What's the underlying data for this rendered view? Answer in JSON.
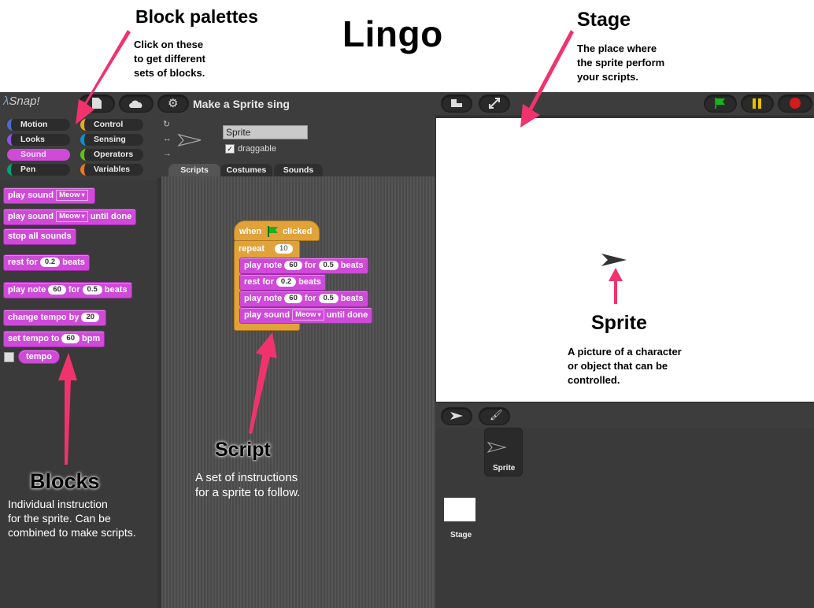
{
  "title": "Lingo",
  "annotations": {
    "palettes": {
      "heading": "Block palettes",
      "text": [
        "Click on these",
        "to get different",
        "sets of blocks."
      ]
    },
    "stage": {
      "heading": "Stage",
      "text": [
        "The place where",
        "the sprite perform",
        "your scripts."
      ]
    },
    "sprite": {
      "heading": "Sprite",
      "text": [
        "A picture of a character",
        "or object that can be",
        "controlled."
      ]
    },
    "script": {
      "heading": "Script",
      "text": [
        "A set of instructions",
        "for a sprite to follow."
      ]
    },
    "blocks": {
      "heading": "Blocks",
      "text": [
        "Individual instruction",
        "for the sprite. Can be",
        "combined to make scripts."
      ]
    }
  },
  "app": {
    "logo": "Snap!",
    "project_title": "Make a Sprite sing"
  },
  "categories": [
    {
      "label": "Motion",
      "color": "#4a6cd4",
      "selected": false
    },
    {
      "label": "Control",
      "color": "#e6a822",
      "selected": false
    },
    {
      "label": "Looks",
      "color": "#8f56e3",
      "selected": false
    },
    {
      "label": "Sensing",
      "color": "#0494dc",
      "selected": false
    },
    {
      "label": "Sound",
      "color": "#cf4ad9",
      "selected": true
    },
    {
      "label": "Operators",
      "color": "#62c213",
      "selected": false
    },
    {
      "label": "Pen",
      "color": "#00a178",
      "selected": false
    },
    {
      "label": "Variables",
      "color": "#f3761d",
      "selected": false
    }
  ],
  "palette_blocks": {
    "play_sound": {
      "pre": "play sound",
      "drop": "Meow"
    },
    "play_sound_done": {
      "pre": "play sound",
      "drop": "Meow",
      "post": "until done"
    },
    "stop_all": {
      "pre": "stop all sounds"
    },
    "rest": {
      "pre": "rest for",
      "num": "0.2",
      "post": "beats"
    },
    "play_note": {
      "pre": "play note",
      "num1": "60",
      "mid": "for",
      "num2": "0.5",
      "post": "beats"
    },
    "change_tempo": {
      "pre": "change tempo by",
      "num": "20"
    },
    "set_tempo": {
      "pre": "set tempo to",
      "num": "60",
      "post": "bpm"
    },
    "tempo": {
      "label": "tempo"
    }
  },
  "sprite": {
    "name": "Sprite",
    "draggable_label": "draggable",
    "draggable": true
  },
  "tabs": [
    {
      "label": "Scripts",
      "selected": true
    },
    {
      "label": "Costumes",
      "selected": false
    },
    {
      "label": "Sounds",
      "selected": false
    }
  ],
  "script": {
    "hat": {
      "pre": "when",
      "post": "clicked"
    },
    "repeat": {
      "label": "repeat",
      "num": "10"
    },
    "note1": {
      "pre": "play note",
      "num1": "60",
      "mid": "for",
      "num2": "0.5",
      "post": "beats"
    },
    "rest": {
      "pre": "rest for",
      "num": "0.2",
      "post": "beats"
    },
    "note2": {
      "pre": "play note",
      "num1": "60",
      "mid": "for",
      "num2": "0.5",
      "post": "beats"
    },
    "sound": {
      "pre": "play sound",
      "drop": "Meow",
      "post": "until done"
    }
  },
  "corral": {
    "sprite_label": "Sprite",
    "stage_label": "Stage"
  },
  "colors": {
    "accent_arrow": "#f0336d",
    "sound_block": "#cf4ad9",
    "control_block": "#e2a23a"
  }
}
